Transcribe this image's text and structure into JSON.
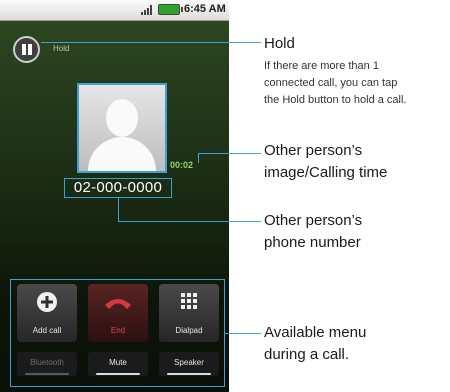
{
  "status_bar": {
    "time": "6:45 AM"
  },
  "call": {
    "hold_label": "Hold",
    "timer": "00:02",
    "phone_number": "02-000-0000"
  },
  "menu": {
    "buttons": [
      {
        "label": "Add call",
        "icon": "add-icon"
      },
      {
        "label": "End",
        "icon": "end-call-icon"
      },
      {
        "label": "Dialpad",
        "icon": "dialpad-icon"
      }
    ],
    "toggles": [
      {
        "label": "Bluetooth"
      },
      {
        "label": "Mute"
      },
      {
        "label": "Speaker"
      }
    ]
  },
  "callouts": {
    "hold": {
      "title": "Hold",
      "desc_lines": [
        "If there are more than 1",
        "connected call, you can tap",
        "the Hold button to hold a call."
      ]
    },
    "image": {
      "lines": [
        "Other person’s",
        "image/Calling time"
      ]
    },
    "number": {
      "lines": [
        "Other person’s",
        "phone number"
      ]
    },
    "menu": {
      "lines": [
        "Available menu",
        "during a call."
      ]
    }
  },
  "colors": {
    "highlight": "#3fa0d8",
    "timer": "#8fd46b",
    "end": "#d74646"
  }
}
